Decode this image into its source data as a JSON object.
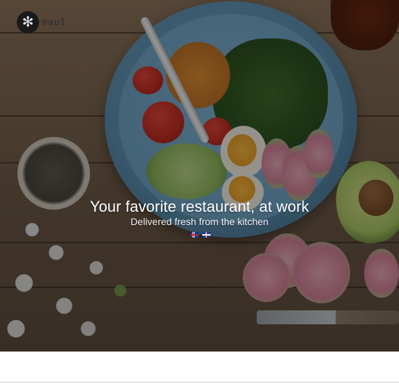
{
  "brand": {
    "name": "maul",
    "logo_icon": "flower-logo-icon"
  },
  "hero": {
    "headline": "Your favorite restaurant, at work",
    "subheadline": "Delivered fresh from the kitchen"
  },
  "languages": [
    {
      "code": "is",
      "icon": "iceland-flag-icon"
    },
    {
      "code": "en",
      "icon": "uk-flag-icon"
    }
  ],
  "colors": {
    "overlay": "#000000",
    "text": "#ffffff",
    "footer": "#ffffff"
  }
}
